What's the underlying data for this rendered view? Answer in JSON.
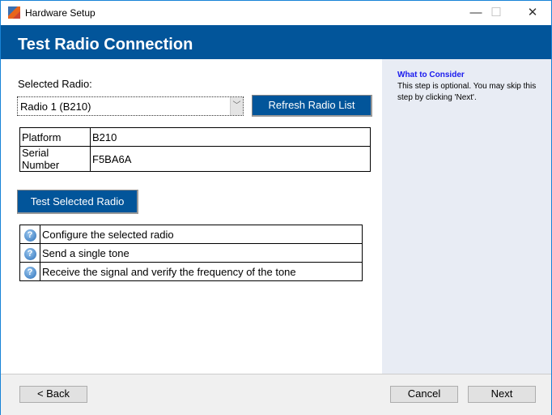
{
  "window": {
    "title": "Hardware Setup",
    "minimize": "—",
    "maximize": "☐",
    "close": "✕"
  },
  "header": {
    "title": "Test Radio Connection"
  },
  "form": {
    "selected_radio_label": "Selected Radio:",
    "selected_radio_value": "Radio 1 (B210)",
    "refresh_label": "Refresh Radio List",
    "test_label": "Test Selected Radio"
  },
  "radio_info": [
    {
      "key": "Platform",
      "value": "B210"
    },
    {
      "key": "Serial Number",
      "value": "F5BA6A"
    }
  ],
  "steps": [
    {
      "icon": "help-icon",
      "text": "Configure the selected radio"
    },
    {
      "icon": "help-icon",
      "text": "Send a single tone"
    },
    {
      "icon": "help-icon",
      "text": "Receive the signal and verify the frequency of the tone"
    }
  ],
  "side": {
    "heading": "What to Consider",
    "text": "This step is optional. You may skip this step by clicking 'Next'."
  },
  "footer": {
    "back": "< Back",
    "cancel": "Cancel",
    "next": "Next"
  }
}
